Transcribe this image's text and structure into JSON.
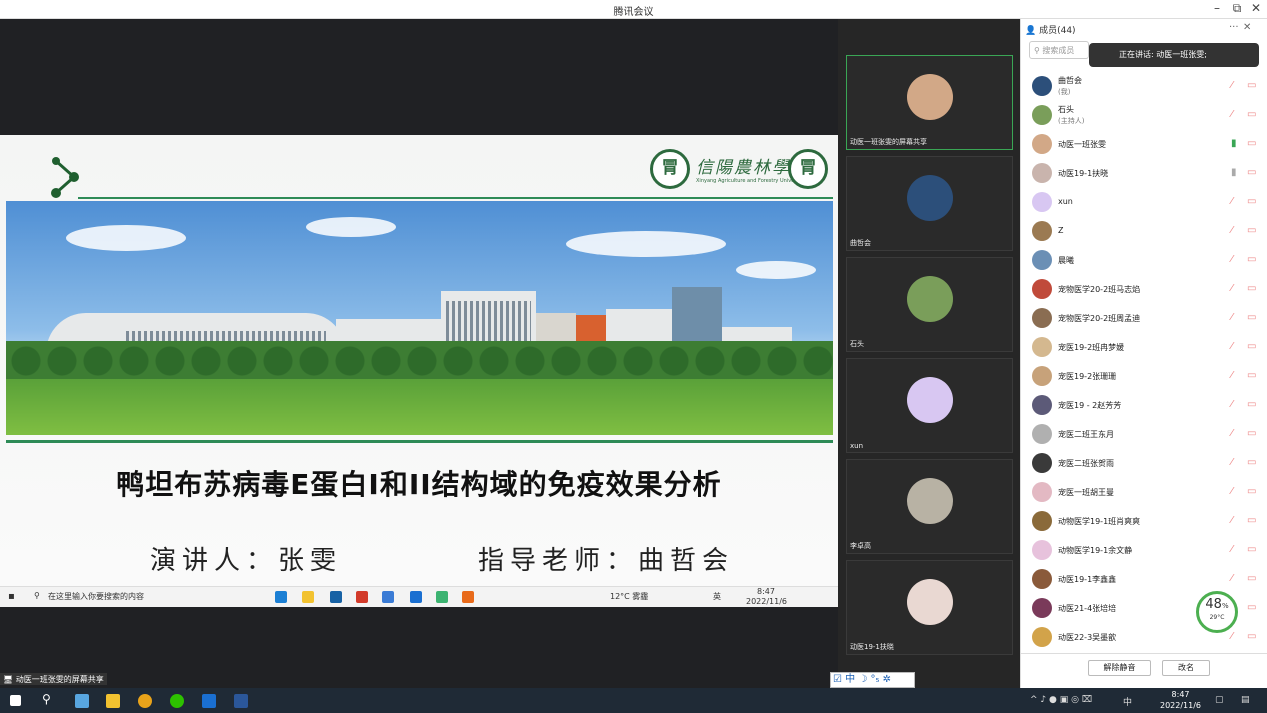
{
  "window": {
    "title": "腾讯会议",
    "controls": [
      "–",
      "⧉",
      "✕"
    ]
  },
  "slide": {
    "logo_cn": "信陽農林學",
    "logo_en": "Xinyang Agriculture and Forestry University",
    "seal_text": "1910",
    "title": "鸭坦布苏病毒E蛋白I和II结构域的免疫效果分析",
    "speaker": "演讲人：张雯",
    "advisor": "指导老师：曲哲会"
  },
  "inner_taskbar": {
    "search_placeholder": "在这里输入你要搜索的内容",
    "weather": "12°C 雾霾",
    "ime": "英",
    "time": "8:47",
    "date": "2022/11/6"
  },
  "video_tiles": [
    {
      "label": "动医一班张雯的屏幕共享",
      "color": "#d2a887",
      "active": true
    },
    {
      "label": "曲哲会",
      "color": "#2c4f7a",
      "active": false
    },
    {
      "label": "石头",
      "color": "#7a9e5a",
      "active": false
    },
    {
      "label": "xun",
      "color": "#d8c7f2",
      "active": false
    },
    {
      "label": "李卓高",
      "color": "#b8b2a4",
      "active": false
    },
    {
      "label": "动医19-1扶晓",
      "color": "#e9d8d2",
      "active": false
    }
  ],
  "share_label": "动医一班张雯的屏幕共享",
  "lang_bar": "☑ 中 ☽ °₅ ✲",
  "panel": {
    "header": "成员(44)",
    "more": "···",
    "close": "✕",
    "search_placeholder": "搜索成员",
    "speaking": "正在讲话: 动医一班张雯;",
    "members": [
      {
        "name": "曲哲会",
        "sub": "(我)",
        "color": "#2c4f7a",
        "mic": "off"
      },
      {
        "name": "石头",
        "sub": "(主持人)",
        "color": "#7a9e5a",
        "mic": "off"
      },
      {
        "name": "动医一班张雯",
        "sub": "",
        "color": "#d2a887",
        "mic": "on"
      },
      {
        "name": "动医19-1扶晓",
        "sub": "",
        "color": "#c9b4ad",
        "mic": "gray"
      },
      {
        "name": "xun",
        "sub": "",
        "color": "#d8c7f2",
        "mic": "off"
      },
      {
        "name": "Z",
        "sub": "",
        "color": "#9b7a52",
        "mic": "off"
      },
      {
        "name": "晨曦",
        "sub": "",
        "color": "#6b8fb5",
        "mic": "off"
      },
      {
        "name": "宠物医学20-2班马志焰",
        "sub": "",
        "color": "#c04a3a",
        "mic": "off"
      },
      {
        "name": "宠物医学20-2班周孟迪",
        "sub": "",
        "color": "#8a6d52",
        "mic": "off"
      },
      {
        "name": "宠医19-2班冉梦媛",
        "sub": "",
        "color": "#d4b88f",
        "mic": "off"
      },
      {
        "name": "宠医19-2张珊珊",
        "sub": "",
        "color": "#c7a27a",
        "mic": "off"
      },
      {
        "name": "宠医19 - 2赵芳芳",
        "sub": "",
        "color": "#5c5a78",
        "mic": "off"
      },
      {
        "name": "宠医二班王东月",
        "sub": "",
        "color": "#b0b0b0",
        "mic": "off"
      },
      {
        "name": "宠医二班张贺雨",
        "sub": "",
        "color": "#3a3a3a",
        "mic": "off"
      },
      {
        "name": "宠医一班胡王曼",
        "sub": "",
        "color": "#e3b9c3",
        "mic": "off"
      },
      {
        "name": "动物医学19-1班肖爽爽",
        "sub": "",
        "color": "#8a6a3a",
        "mic": "off"
      },
      {
        "name": "动物医学19-1余文静",
        "sub": "",
        "color": "#e7c2dc",
        "mic": "off"
      },
      {
        "name": "动医19-1李鑫鑫",
        "sub": "",
        "color": "#8a5a3a",
        "mic": "off"
      },
      {
        "name": "动医21-4张培培",
        "sub": "",
        "color": "#7a3a5a",
        "mic": "off"
      },
      {
        "name": "动医22-3吴墨歆",
        "sub": "",
        "color": "#d2a34a",
        "mic": "off"
      }
    ],
    "unmute_all": "解除静音",
    "rename": "改名"
  },
  "gauge": {
    "percent": "48",
    "unit": "%",
    "temp": "29°C"
  },
  "taskbar": {
    "time": "8:47",
    "date": "2022/11/6",
    "ime": "中"
  }
}
